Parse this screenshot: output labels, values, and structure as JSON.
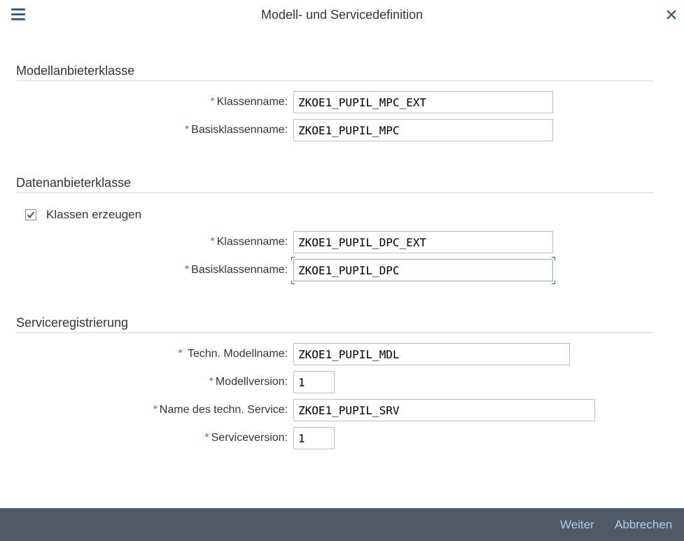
{
  "dialog": {
    "title": "Modell- und Servicedefinition"
  },
  "model_provider": {
    "title": "Modellanbieterklasse",
    "class_name_label": "Klassenname:",
    "class_name_value": "ZKOE1_PUPIL_MPC_EXT",
    "base_class_label": "Basisklassenname:",
    "base_class_value": "ZKOE1_PUPIL_MPC"
  },
  "data_provider": {
    "title": "Datenanbieterklasse",
    "generate_label": "Klassen erzeugen",
    "generate_checked": true,
    "class_name_label": "Klassenname:",
    "class_name_value": "ZKOE1_PUPIL_DPC_EXT",
    "base_class_label": "Basisklassenname:",
    "base_class_value": "ZKOE1_PUPIL_DPC"
  },
  "service_registration": {
    "title": "Serviceregistrierung",
    "model_name_label": "Techn. Modellname:",
    "model_name_value": "ZKOE1_PUPIL_MDL",
    "model_version_label": "Modellversion:",
    "model_version_value": "1",
    "service_name_label": "Name des techn. Service:",
    "service_name_value": "ZKOE1_PUPIL_SRV",
    "service_version_label": "Serviceversion:",
    "service_version_value": "1"
  },
  "footer": {
    "next_label": "Weiter",
    "cancel_label": "Abbrechen"
  },
  "colors": {
    "required": "#e34352",
    "footer_bg": "#4f5a65",
    "footer_link": "#a6d1f1",
    "icon": "#346187"
  },
  "icons": {
    "menu": "hamburger-menu-icon",
    "close": "close-icon",
    "check": "checkmark-icon"
  }
}
